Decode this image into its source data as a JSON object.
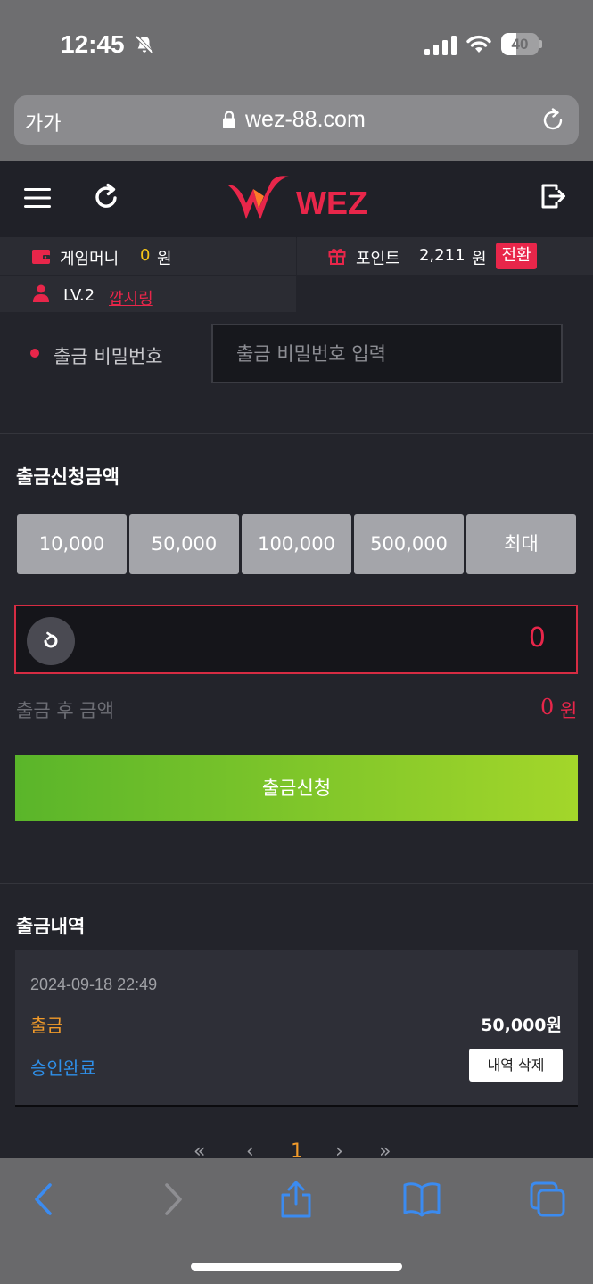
{
  "status_bar": {
    "time": "12:45",
    "battery": "40",
    "battery_level": 0.4
  },
  "browser": {
    "text_size": "가가",
    "url": "wez-88.com"
  },
  "header": {
    "logo": "WEZ"
  },
  "info": {
    "game_money_label": "게임머니",
    "game_money_value": "0",
    "game_money_unit": "원",
    "points_label": "포인트",
    "points_value": "2,211",
    "points_unit": "원",
    "convert_label": "전환",
    "level": "LV.2",
    "nickname": "깝시링"
  },
  "password": {
    "label": "출금 비밀번호",
    "placeholder": "출금 비밀번호 입력"
  },
  "amount": {
    "title": "출금신청금액",
    "quick_buttons": [
      "10,000",
      "50,000",
      "100,000",
      "500,000",
      "최대"
    ],
    "value": "0",
    "after_label": "출금 후 금액",
    "after_value": "0",
    "after_unit": "원",
    "submit_label": "출금신청"
  },
  "history": {
    "title": "출금내역",
    "items": [
      {
        "date": "2024-09-18 22:49",
        "type": "출금",
        "amount": "50,000원",
        "status": "승인완료",
        "delete_label": "내역 삭제"
      }
    ]
  },
  "pagination": {
    "first": "«",
    "prev": "‹",
    "current": "1",
    "next": "›",
    "last": "»"
  },
  "colors": {
    "accent": "#e8264a",
    "submit_start": "#5ab52a",
    "submit_end": "#a3d62a",
    "history_type": "#f09a2a",
    "history_status": "#2f8fe8"
  }
}
